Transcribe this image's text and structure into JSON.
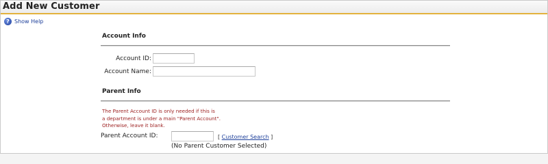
{
  "page": {
    "title": "Add New Customer"
  },
  "help": {
    "label": "Show Help",
    "icon": "help-question-icon"
  },
  "account_info": {
    "heading": "Account Info",
    "account_id": {
      "label": "Account ID:",
      "value": ""
    },
    "account_name": {
      "label": "Account Name:",
      "value": ""
    }
  },
  "parent_info": {
    "heading": "Parent Info",
    "note": [
      "The Parent Account ID is only needed if this is",
      "a department is under a main \"Parent Account\".",
      "Otherwise, leave it blank."
    ],
    "parent_account_id": {
      "label": "Parent Account ID:",
      "value": ""
    },
    "search": {
      "bracket_open": "[ ",
      "link": "Customer Search",
      "bracket_close": " ]"
    },
    "selected_status": "(No Parent Customer Selected)"
  },
  "colors": {
    "accent_rule": "#e3b23c",
    "note_text": "#9b1c1c",
    "link": "#1d3f9a"
  }
}
